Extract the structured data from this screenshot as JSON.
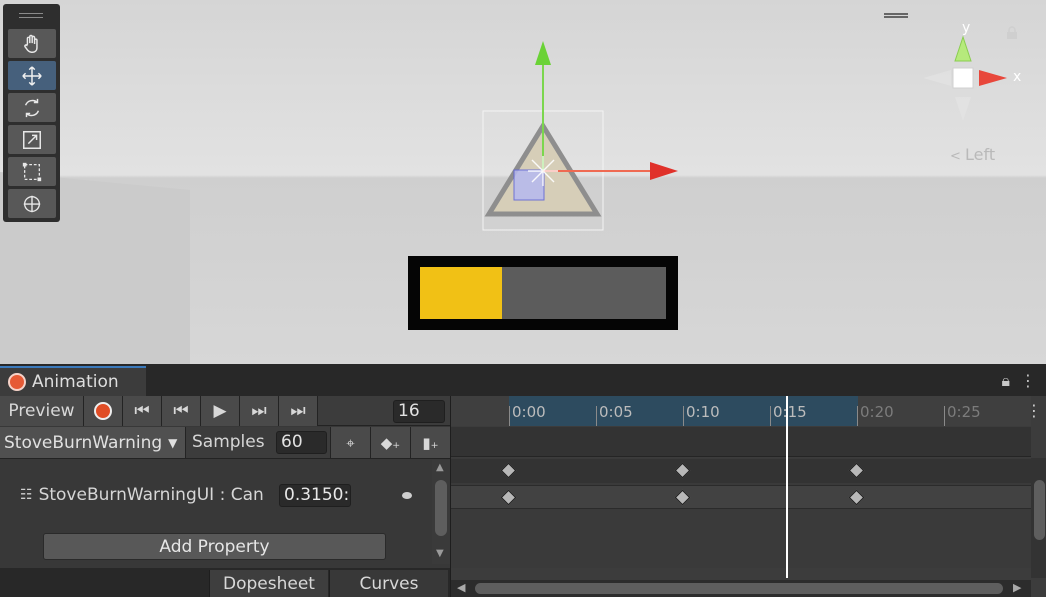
{
  "scene": {
    "orientation_label": "Left",
    "axis_y": "y",
    "axis_x": "x",
    "health_bar_fill": 0.335,
    "colors": {
      "bar_fill": "#f1c115",
      "bar_track": "#5c5c5c",
      "accent": "#3a79bb"
    },
    "tools": [
      "hand-icon",
      "move-icon",
      "rotate-icon",
      "scale-icon",
      "rect-icon",
      "transform-icon"
    ],
    "active_tool": "move-icon"
  },
  "animation": {
    "tab_title": "Animation",
    "preview_label": "Preview",
    "frame_value": "16",
    "clip_name": "StoveBurnWarning",
    "samples_label": "Samples",
    "samples_value": "60",
    "property_name": "StoveBurnWarningUI : Can",
    "property_value": "0.3150:",
    "add_property_label": "Add Property",
    "dopesheet_label": "Dopesheet",
    "curves_label": "Curves",
    "ruler_ticks": [
      "0:00",
      "0:05",
      "0:10",
      "0:15",
      "0:20",
      "0:25"
    ],
    "keyframes": [
      "0:00",
      "0:10",
      "0:20"
    ],
    "playhead": "0:16"
  }
}
